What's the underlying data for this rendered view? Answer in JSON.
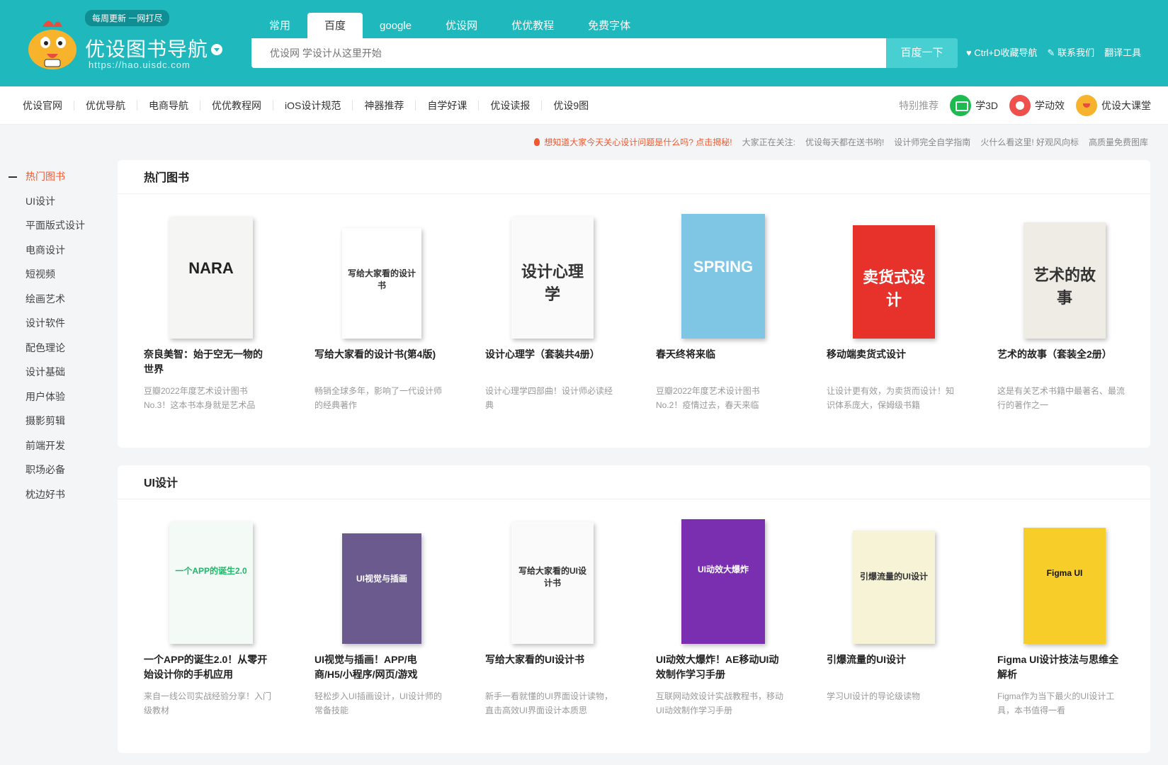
{
  "header": {
    "logo_bubble": "每周更新 一网打尽",
    "logo_title": "优设图书导航",
    "logo_url": "https://hao.uisdc.com",
    "tabs": [
      "常用",
      "百度",
      "google",
      "优设网",
      "优优教程",
      "免费字体"
    ],
    "active_tab": 1,
    "search_placeholder": "优设网 学设计从这里开始",
    "search_button": "百度一下",
    "links": [
      "Ctrl+D收藏导航",
      "联系我们",
      "翻译工具"
    ]
  },
  "nav": {
    "items": [
      "优设官网",
      "优优导航",
      "电商导航",
      "优优教程网",
      "iOS设计规范",
      "神器推荐",
      "自学好课",
      "优设读报",
      "优设9图"
    ],
    "recommend_label": "特别推荐",
    "courses": [
      {
        "label": "学3D",
        "icon": "monitor-icon",
        "color": "#1dbb4f"
      },
      {
        "label": "学动效",
        "icon": "play-icon",
        "color": "#f0504c"
      },
      {
        "label": "优设大课堂",
        "icon": "mascot-icon",
        "color": "#f7b32b"
      }
    ]
  },
  "notice": {
    "hot": "想知道大家今天关心设计问题是什么吗? 点击揭秘!",
    "label": "大家正在关注:",
    "items": [
      "优设每天都在送书哟!",
      "设计师完全自学指南",
      "火什么看这里! 好观风向标",
      "高质量免费图库"
    ]
  },
  "sidebar": {
    "items": [
      "热门图书",
      "UI设计",
      "平面版式设计",
      "电商设计",
      "短视频",
      "绘画艺术",
      "设计软件",
      "配色理论",
      "设计基础",
      "用户体验",
      "摄影剪辑",
      "前端开发",
      "职场必备",
      "枕边好书"
    ],
    "active": 0
  },
  "sections": [
    {
      "title": "热门图书",
      "books": [
        {
          "title": "奈良美智：始于空无一物的世界",
          "desc": "豆瓣2022年度艺术设计图书No.3！这本书本身就是艺术品",
          "cover_text": "NARA",
          "cover_bg": "#f5f5f3",
          "cover_fg": "#222"
        },
        {
          "title": "写给大家看的设计书(第4版)",
          "desc": "畅销全球多年，影响了一代设计师的经典著作",
          "cover_text": "写给大家看的设计书",
          "cover_bg": "#ffffff",
          "cover_fg": "#333"
        },
        {
          "title": "设计心理学（套装共4册）",
          "desc": "设计心理学四部曲！设计师必读经典",
          "cover_text": "设计心理学",
          "cover_bg": "#fafafa",
          "cover_fg": "#333"
        },
        {
          "title": "春天终将来临",
          "desc": "豆瓣2022年度艺术设计图书No.2！疫情过去，春天来临",
          "cover_text": "SPRING",
          "cover_bg": "#7ec6e3",
          "cover_fg": "#fff"
        },
        {
          "title": "移动端卖货式设计",
          "desc": "让设计更有效，为卖货而设计！知识体系庞大，保姆级书籍",
          "cover_text": "卖货式设计",
          "cover_bg": "#e7312b",
          "cover_fg": "#fff"
        },
        {
          "title": "艺术的故事（套装全2册）",
          "desc": "这是有关艺术书籍中最著名、最流行的著作之一",
          "cover_text": "艺术的故事",
          "cover_bg": "#efece6",
          "cover_fg": "#333"
        }
      ]
    },
    {
      "title": "UI设计",
      "books": [
        {
          "title": "一个APP的诞生2.0！从零开始设计你的手机应用",
          "desc": "来自一线公司实战经验分享！入门级教材",
          "cover_text": "一个APP的诞生2.0",
          "cover_bg": "#f4fbf6",
          "cover_fg": "#1fb86b"
        },
        {
          "title": "UI视觉与插画！APP/电商/H5/小程序/网页/游戏",
          "desc": "轻松步入UI插画设计，UI设计师的常备技能",
          "cover_text": "UI视觉与插画",
          "cover_bg": "#6a5a8e",
          "cover_fg": "#fff"
        },
        {
          "title": "写给大家看的UI设计书",
          "desc": "新手一看就懂的UI界面设计读物，直击高效UI界面设计本质思",
          "cover_text": "写给大家看的UI设计书",
          "cover_bg": "#fafafa",
          "cover_fg": "#333"
        },
        {
          "title": "UI动效大爆炸！AE移动UI动效制作学习手册",
          "desc": "互联网动效设计实战教程书，移动UI动效制作学习手册",
          "cover_text": "UI动效大爆炸",
          "cover_bg": "#7a2fb0",
          "cover_fg": "#fff"
        },
        {
          "title": "引爆流量的UI设计",
          "desc": "学习UI设计的导论级读物",
          "cover_text": "引爆流量的UI设计",
          "cover_bg": "#f7f3d6",
          "cover_fg": "#333"
        },
        {
          "title": "Figma UI设计技法与思维全解析",
          "desc": "Figma作为当下最火的UI设计工具，本书值得一看",
          "cover_text": "Figma UI",
          "cover_bg": "#f7cd2a",
          "cover_fg": "#111"
        }
      ]
    }
  ]
}
